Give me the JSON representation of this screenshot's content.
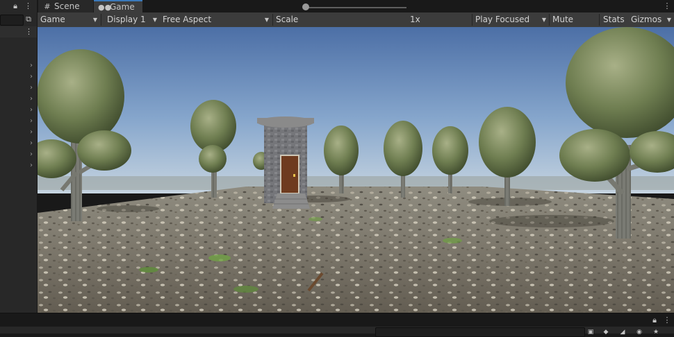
{
  "tabs": [
    {
      "label": "Scene",
      "icon": "hash-grid-icon",
      "active": false
    },
    {
      "label": "Game",
      "icon": "gamepad-icon",
      "active": true
    }
  ],
  "toolbar": {
    "view_mode": "Game",
    "display": "Display 1",
    "aspect": "Free Aspect",
    "scale_label": "Scale",
    "scale_value": "1x",
    "scale_fraction": 0.0,
    "play_mode": "Play Focused",
    "mute_audio": "Mute Audio",
    "stats": "Stats",
    "gizmos": "Gizmos"
  },
  "hierarchy": {
    "collapsed_rows": 10
  },
  "colors": {
    "active_tab_accent": "#3a79bb",
    "panel_bg": "#282828",
    "toolbar_bg": "#3c3c3c"
  }
}
